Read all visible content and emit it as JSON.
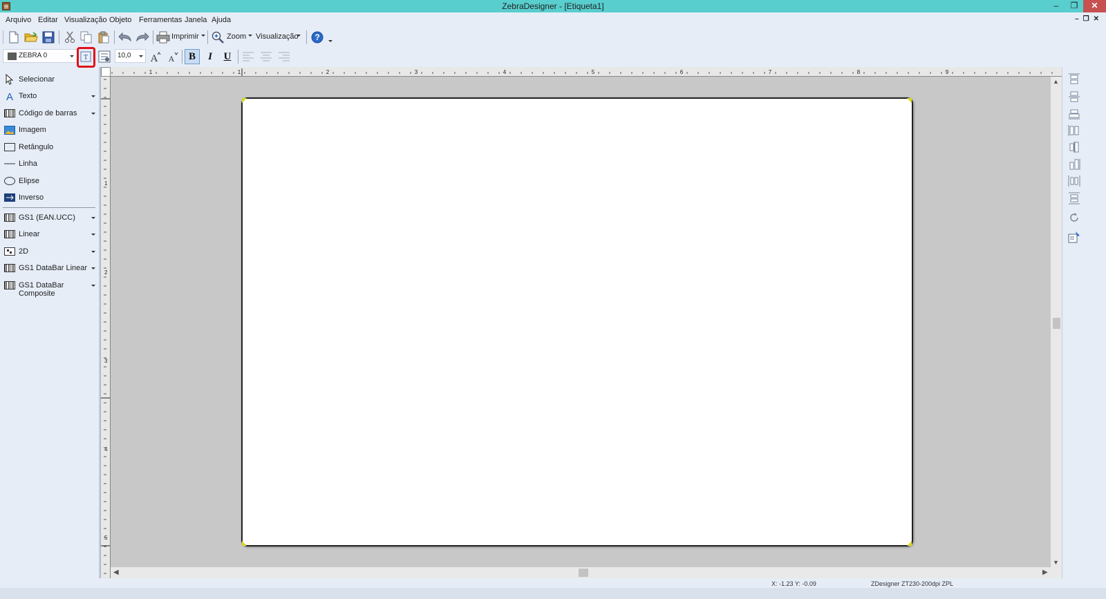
{
  "window": {
    "title": "ZebraDesigner - [Etiqueta1]"
  },
  "menu": [
    "Arquivo",
    "Editar",
    "Visualização",
    "Objeto",
    "Ferramentas",
    "Janela",
    "Ajuda"
  ],
  "toolbar": {
    "print_label": "Imprimir",
    "zoom_label": "Zoom",
    "view_label": "Visualização",
    "printer_font": "ZEBRA 0",
    "font_size": "10,0",
    "bold": "B",
    "italic": "I",
    "underline": "U"
  },
  "tools": {
    "select": "Selecionar",
    "text": "Texto",
    "barcode": "Código de barras",
    "image": "Imagem",
    "rectangle": "Retângulo",
    "line": "Linha",
    "ellipse": "Elipse",
    "inverse": "Inverso",
    "gs1_ean": "GS1 (EAN.UCC)",
    "linear": "Linear",
    "twod": "2D",
    "gs1_databar_linear": "GS1 DataBar Linear",
    "gs1_databar_composite": "GS1 DataBar Composite"
  },
  "ruler": {
    "h_labels": [
      "1",
      "1",
      "2",
      "3",
      "4",
      "5",
      "6",
      "7",
      "8",
      "9"
    ],
    "v_labels": [
      "1",
      "2",
      "3",
      "4",
      "5"
    ]
  },
  "status": {
    "coords": "X: -1.23 Y: -0.09",
    "printer": "ZDesigner ZT230-200dpi ZPL"
  },
  "colors": {
    "titlebar": "#58cece",
    "close_button": "#c75050",
    "highlight": "#e0101a",
    "chrome": "#e6edf7"
  },
  "icons": [
    "new-document-icon",
    "open-folder-icon",
    "save-icon",
    "cut-icon",
    "copy-icon",
    "paste-icon",
    "undo-icon",
    "redo-icon",
    "printer-icon",
    "zoom-icon",
    "help-icon"
  ]
}
